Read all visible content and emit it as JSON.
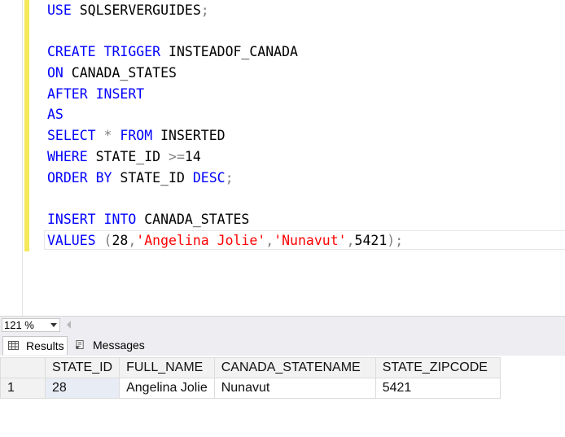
{
  "editor": {
    "lines": [
      [
        {
          "t": "USE",
          "c": "kw"
        },
        {
          "t": " SQLSERVERGUIDES",
          "c": ""
        },
        {
          "t": ";",
          "c": "pn"
        }
      ],
      [],
      [
        {
          "t": "CREATE",
          "c": "kw"
        },
        {
          "t": " ",
          "c": ""
        },
        {
          "t": "TRIGGER",
          "c": "kw"
        },
        {
          "t": " INSTEADOF_CANADA",
          "c": ""
        }
      ],
      [
        {
          "t": "ON",
          "c": "kw"
        },
        {
          "t": " CANADA_STATES",
          "c": ""
        }
      ],
      [
        {
          "t": "AFTER",
          "c": "kw"
        },
        {
          "t": " ",
          "c": ""
        },
        {
          "t": "INSERT",
          "c": "kw"
        }
      ],
      [
        {
          "t": "AS",
          "c": "kw"
        }
      ],
      [
        {
          "t": "SELECT",
          "c": "kw"
        },
        {
          "t": " ",
          "c": ""
        },
        {
          "t": "*",
          "c": "op"
        },
        {
          "t": " ",
          "c": ""
        },
        {
          "t": "FROM",
          "c": "kw"
        },
        {
          "t": " INSERTED",
          "c": ""
        }
      ],
      [
        {
          "t": "WHERE",
          "c": "kw"
        },
        {
          "t": " STATE_ID ",
          "c": ""
        },
        {
          "t": ">=",
          "c": "op"
        },
        {
          "t": "14",
          "c": ""
        }
      ],
      [
        {
          "t": "ORDER",
          "c": "kw"
        },
        {
          "t": " ",
          "c": ""
        },
        {
          "t": "BY",
          "c": "kw"
        },
        {
          "t": " STATE_ID ",
          "c": ""
        },
        {
          "t": "DESC",
          "c": "kw"
        },
        {
          "t": ";",
          "c": "pn"
        }
      ],
      [],
      [
        {
          "t": "INSERT",
          "c": "kw"
        },
        {
          "t": " ",
          "c": ""
        },
        {
          "t": "INTO",
          "c": "kw"
        },
        {
          "t": " CANADA_STATES",
          "c": ""
        }
      ],
      [
        {
          "t": "VALUES",
          "c": "kw"
        },
        {
          "t": " ",
          "c": ""
        },
        {
          "t": "(",
          "c": "pn"
        },
        {
          "t": "28",
          "c": ""
        },
        {
          "t": ",",
          "c": "pn"
        },
        {
          "t": "'Angelina Jolie'",
          "c": "str"
        },
        {
          "t": ",",
          "c": "pn"
        },
        {
          "t": "'Nunavut'",
          "c": "str"
        },
        {
          "t": ",",
          "c": "pn"
        },
        {
          "t": "5421",
          "c": ""
        },
        {
          "t": ");",
          "c": "pn"
        }
      ]
    ],
    "current_line_index": 11
  },
  "zoom": {
    "value": "121 %"
  },
  "tabs": {
    "results_label": "Results",
    "messages_label": "Messages"
  },
  "grid": {
    "columns": [
      "STATE_ID",
      "FULL_NAME",
      "CANADA_STATENAME",
      "STATE_ZIPCODE"
    ],
    "rows": [
      {
        "row_number": "1",
        "cells": [
          "28",
          "Angelina Jolie",
          "Nunavut",
          "5421"
        ]
      }
    ]
  },
  "colors": {
    "keyword": "#0000ff",
    "string": "#ff0000",
    "operator": "#808080",
    "change_bar": "#f3e95a"
  }
}
